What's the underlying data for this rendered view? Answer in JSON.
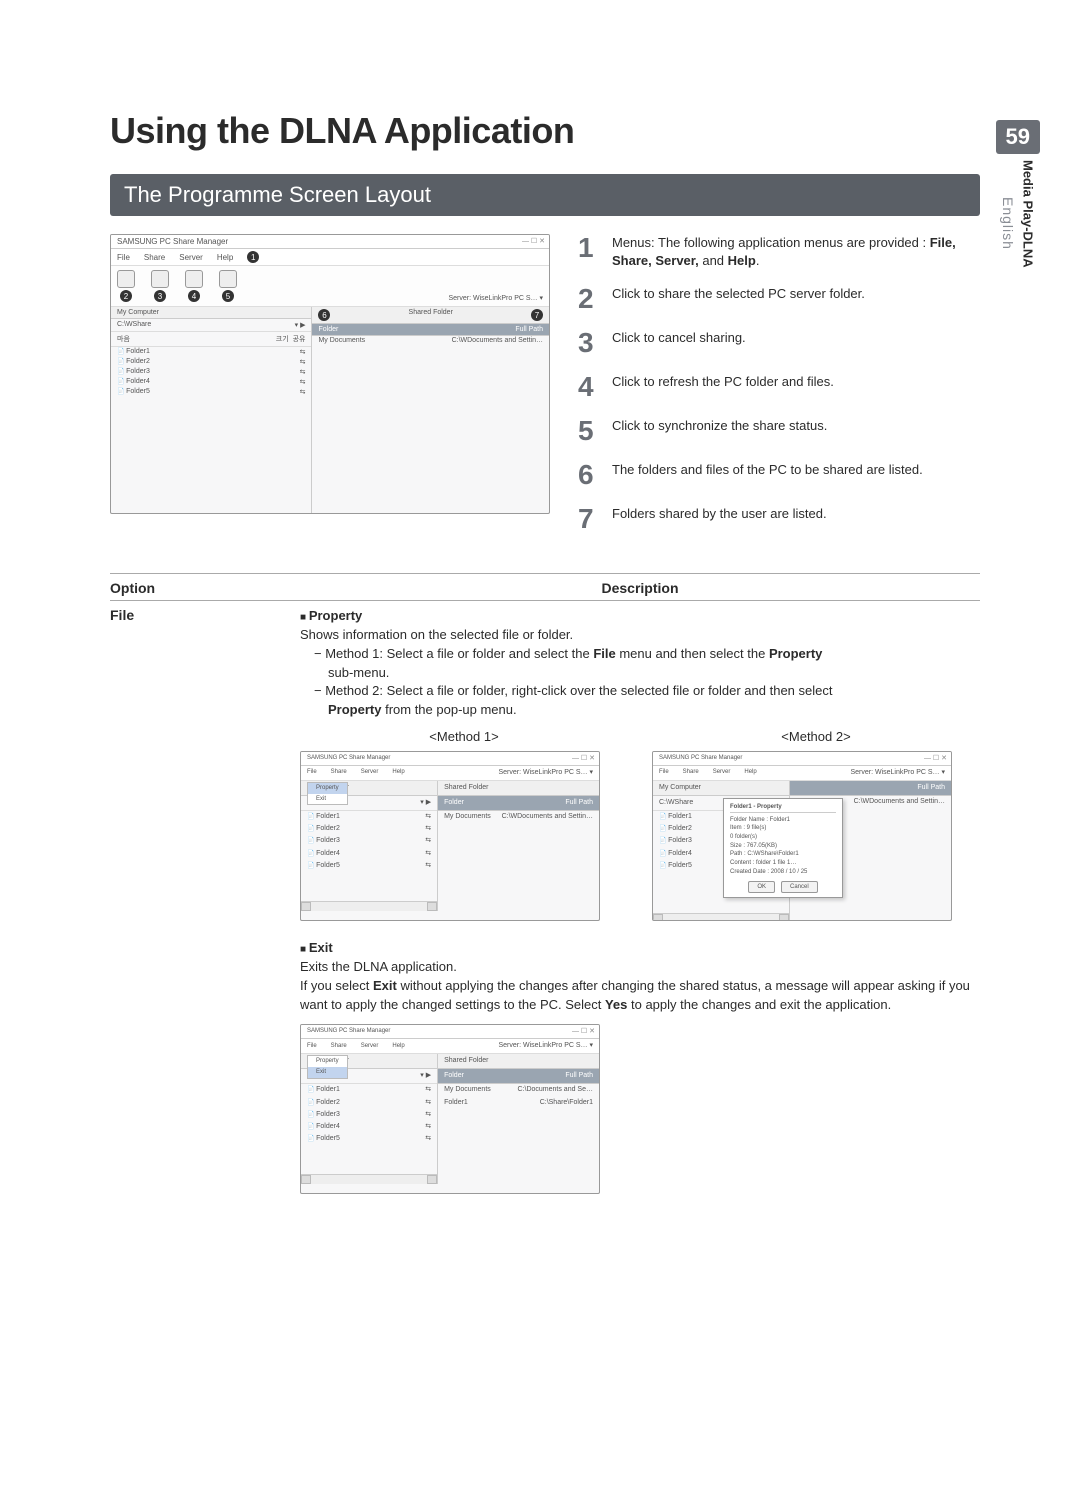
{
  "page_number": "59",
  "language_tab": "English",
  "breadcrumb_tab": "Media Play-DLNA",
  "title": "Using the DLNA Application",
  "section_heading": "The Programme Screen Layout",
  "screenshot_main": {
    "window_title": "SAMSUNG PC Share Manager",
    "menus": [
      "File",
      "Share",
      "Server",
      "Help"
    ],
    "menu_badge": "1",
    "toolbar_badges": [
      "2",
      "3",
      "4",
      "5"
    ],
    "server_label": "Server:",
    "server_value": "WiseLinkPro PC S…  ▾",
    "left": {
      "header": "My Computer",
      "path": "C:\\WShare",
      "col1": "마음",
      "col2": "크기",
      "share_col": "공유",
      "folders": [
        "Folder1",
        "Folder2",
        "Folder3",
        "Folder4",
        "Folder5"
      ]
    },
    "right": {
      "header": "Shared Folder",
      "header_badge_left": "6",
      "header_badge_right": "7",
      "cols": [
        "Folder",
        "Full Path"
      ],
      "row_folder": "My Documents",
      "row_path": "C:\\WDocuments and Settin…"
    }
  },
  "callouts": [
    {
      "n": "1",
      "text_a": "Menus: The following application menus are provided : ",
      "bold": "File, Share, Server,",
      "text_b": " and ",
      "bold2": "Help",
      "text_c": "."
    },
    {
      "n": "2",
      "text_a": "Click to share the selected PC server folder."
    },
    {
      "n": "3",
      "text_a": "Click to cancel sharing."
    },
    {
      "n": "4",
      "text_a": "Click to refresh the PC folder and files."
    },
    {
      "n": "5",
      "text_a": "Click to synchronize the share status."
    },
    {
      "n": "6",
      "text_a": "The folders and files of the PC to be shared are listed."
    },
    {
      "n": "7",
      "text_a": "Folders shared by the user are listed."
    }
  ],
  "option_table": {
    "head_option": "Option",
    "head_desc": "Description",
    "row_label": "File",
    "property": {
      "heading": "Property",
      "line1": "Shows information on the selected file or folder.",
      "m1a": "−  Method 1: Select a file or folder and select the ",
      "m1b": "File",
      "m1c": " menu and then select the ",
      "m1d": "Property",
      "m1e": " sub-menu.",
      "m2a": "−  Method 2: Select a file or folder, right-click over the selected file or folder and then select ",
      "m2b": "Property",
      "m2c": " from the pop-up menu."
    },
    "method1_label": "<Method 1>",
    "method2_label": "<Method 2>",
    "method1_dropdown": {
      "item_sel": "Property",
      "item2": "Exit"
    },
    "method2_popup": {
      "title": "Folder1 - Property",
      "lines": [
        "Folder Name : Folder1",
        "Item :            9  file(s)",
        "                    0  folder(s)",
        "Size : 767.05(KB)",
        "Path : C:\\WShare\\Folder1",
        "Content : folder 1 file 1…",
        "Created Date : 2008 / 10 / 25"
      ],
      "btn_ok": "OK",
      "btn_cancel": "Cancel",
      "right_col": "Full Path",
      "right_row": "C:\\WDocuments and Settin…"
    },
    "exit": {
      "heading": "Exit",
      "line1": "Exits the DLNA application.",
      "line2a": "If you select ",
      "line2b": "Exit",
      "line2c": " without applying the changes after changing the shared status, a message will appear asking if you want to apply the changed settings to the PC. Select ",
      "line2d": "Yes",
      "line2e": " to apply the changes and exit the application."
    },
    "exit_shot": {
      "dropdown": {
        "item1": "Property",
        "item_sel": "Exit"
      },
      "right_rows": [
        {
          "f": "My Documents",
          "p": "C:\\Documents and Se…"
        },
        {
          "f": "Folder1",
          "p": "C:\\Share\\Folder1"
        }
      ]
    }
  }
}
